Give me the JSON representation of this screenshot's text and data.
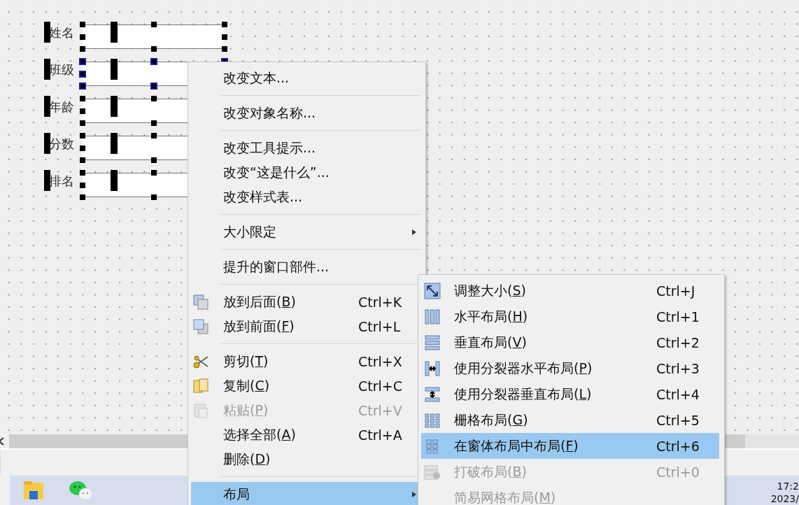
{
  "form": {
    "rows": [
      {
        "label": "姓名",
        "selected": false
      },
      {
        "label": "班级",
        "selected": true
      },
      {
        "label": "年龄",
        "selected": false
      },
      {
        "label": "分数",
        "selected": false
      },
      {
        "label": "排名",
        "selected": false
      }
    ]
  },
  "context_menu": {
    "items": [
      {
        "kind": "item",
        "label": "改变文本...",
        "submenu": false,
        "disabled": false,
        "selected": false
      },
      {
        "kind": "separator"
      },
      {
        "kind": "item",
        "label": "改变对象名称...",
        "submenu": false,
        "disabled": false,
        "selected": false
      },
      {
        "kind": "separator"
      },
      {
        "kind": "item",
        "label": "改变工具提示...",
        "submenu": false,
        "disabled": false,
        "selected": false
      },
      {
        "kind": "item",
        "label": "改变“这是什么”...",
        "submenu": false,
        "disabled": false,
        "selected": false
      },
      {
        "kind": "item",
        "label": "改变样式表...",
        "submenu": false,
        "disabled": false,
        "selected": false
      },
      {
        "kind": "separator"
      },
      {
        "kind": "item",
        "label": "大小限定",
        "submenu": true,
        "disabled": false,
        "selected": false
      },
      {
        "kind": "separator"
      },
      {
        "kind": "item",
        "label": "提升的窗口部件...",
        "submenu": false,
        "disabled": false,
        "selected": false
      },
      {
        "kind": "separator"
      },
      {
        "kind": "item",
        "label": "放到后面(",
        "mnemonic": "B",
        "label_end": ")",
        "shortcut": "Ctrl+K",
        "submenu": false,
        "disabled": false,
        "selected": false
      },
      {
        "kind": "item",
        "label": "放到前面(",
        "mnemonic": "F",
        "label_end": ")",
        "shortcut": "Ctrl+L",
        "submenu": false,
        "disabled": false,
        "selected": false
      },
      {
        "kind": "separator"
      },
      {
        "kind": "item",
        "label": "剪切(",
        "mnemonic": "T",
        "label_end": ")",
        "shortcut": "Ctrl+X",
        "submenu": false,
        "disabled": false,
        "selected": false
      },
      {
        "kind": "item",
        "label": "复制(",
        "mnemonic": "C",
        "label_end": ")",
        "shortcut": "Ctrl+C",
        "submenu": false,
        "disabled": false,
        "selected": false
      },
      {
        "kind": "item",
        "label": "粘贴(",
        "mnemonic": "P",
        "label_end": ")",
        "shortcut": "Ctrl+V",
        "submenu": false,
        "disabled": true,
        "selected": false
      },
      {
        "kind": "item",
        "label": "选择全部(",
        "mnemonic": "A",
        "label_end": ")",
        "shortcut": "Ctrl+A",
        "submenu": false,
        "disabled": false,
        "selected": false
      },
      {
        "kind": "item",
        "label": "删除(",
        "mnemonic": "D",
        "label_end": ")",
        "submenu": false,
        "disabled": false,
        "selected": false
      },
      {
        "kind": "separator"
      },
      {
        "kind": "item",
        "label": "布局",
        "submenu": true,
        "disabled": false,
        "selected": true
      }
    ]
  },
  "layout_submenu": {
    "items": [
      {
        "label": "调整大小(",
        "mnemonic": "S",
        "label_end": ")",
        "shortcut": "Ctrl+J",
        "disabled": false,
        "selected": false
      },
      {
        "label": "水平布局(",
        "mnemonic": "H",
        "label_end": ")",
        "shortcut": "Ctrl+1",
        "disabled": false,
        "selected": false
      },
      {
        "label": "垂直布局(",
        "mnemonic": "V",
        "label_end": ")",
        "shortcut": "Ctrl+2",
        "disabled": false,
        "selected": false
      },
      {
        "label": "使用分裂器水平布局(",
        "mnemonic": "P",
        "label_end": ")",
        "shortcut": "Ctrl+3",
        "disabled": false,
        "selected": false
      },
      {
        "label": "使用分裂器垂直布局(",
        "mnemonic": "L",
        "label_end": ")",
        "shortcut": "Ctrl+4",
        "disabled": false,
        "selected": false
      },
      {
        "label": "栅格布局(",
        "mnemonic": "G",
        "label_end": ")",
        "shortcut": "Ctrl+5",
        "disabled": false,
        "selected": false
      },
      {
        "label": "在窗体布局中布局(",
        "mnemonic": "F",
        "label_end": ")",
        "shortcut": "Ctrl+6",
        "disabled": false,
        "selected": true
      },
      {
        "label": "打破布局(",
        "mnemonic": "B",
        "label_end": ")",
        "shortcut": "Ctrl+0",
        "disabled": true,
        "selected": false
      },
      {
        "label": "简易网格布局(",
        "mnemonic": "M",
        "label_end": ")",
        "disabled": true,
        "selected": false
      }
    ]
  },
  "taskbar": {
    "clock_time": "17:2",
    "clock_date": "2023/"
  }
}
